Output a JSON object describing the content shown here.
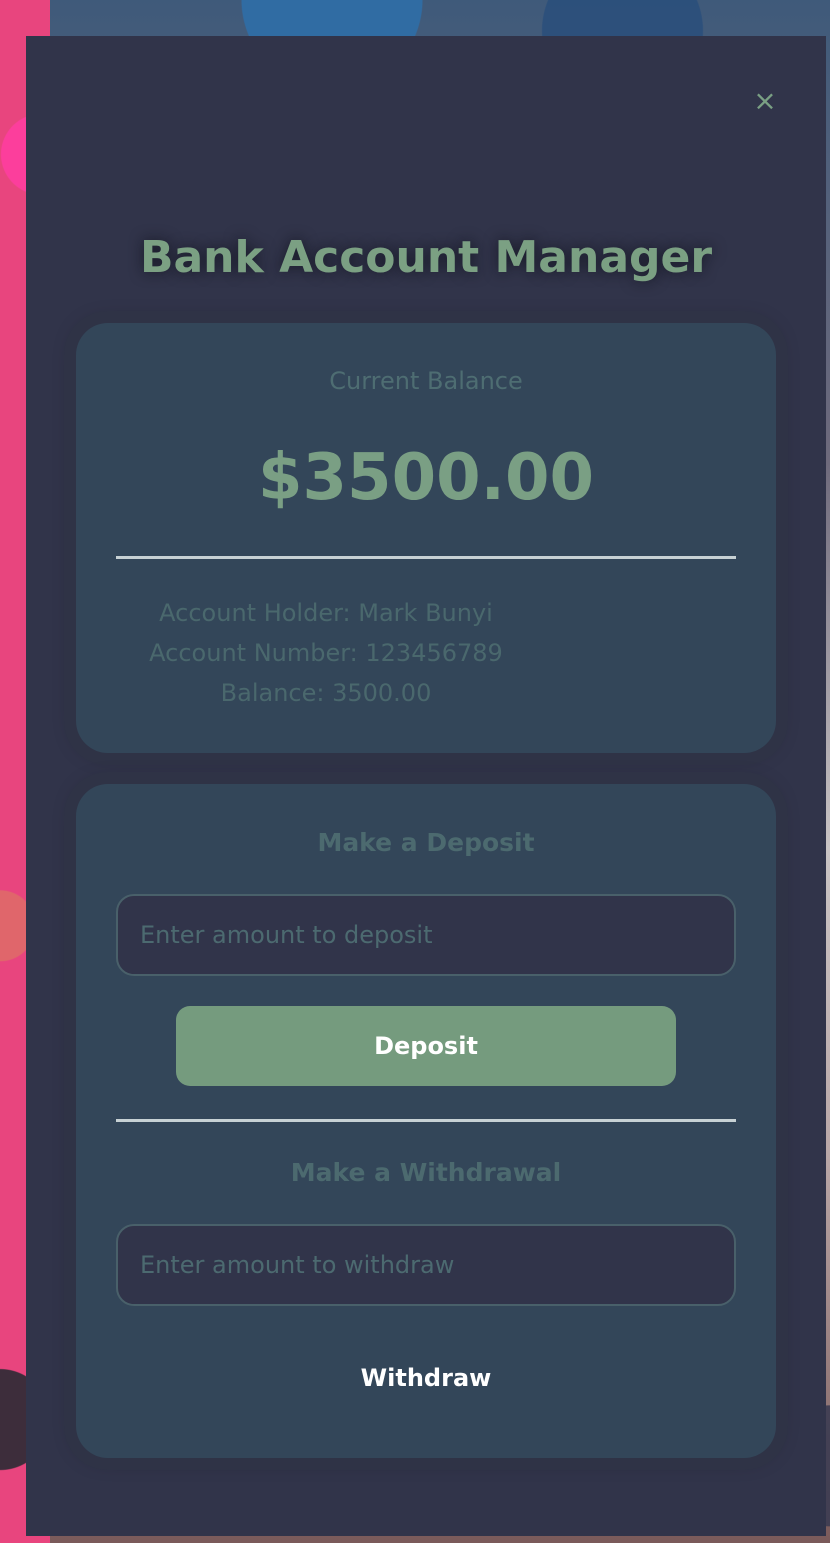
{
  "app": {
    "title": "Bank Account Manager",
    "close_label": "×"
  },
  "balance_card": {
    "label": "Current Balance",
    "amount": "$3500.00",
    "details": {
      "holder": "Account Holder: Mark Bunyi",
      "number": "Account Number: 123456789",
      "balance": "Balance: 3500.00"
    }
  },
  "deposit": {
    "title": "Make a Deposit",
    "placeholder": "Enter amount to deposit",
    "button_label": "Deposit"
  },
  "withdraw": {
    "title": "Make a Withdrawal",
    "placeholder": "Enter amount to withdraw",
    "button_label": "Withdraw"
  },
  "colors": {
    "accent": "#759b7e",
    "panel": "#334659",
    "modal": "#31344a"
  }
}
